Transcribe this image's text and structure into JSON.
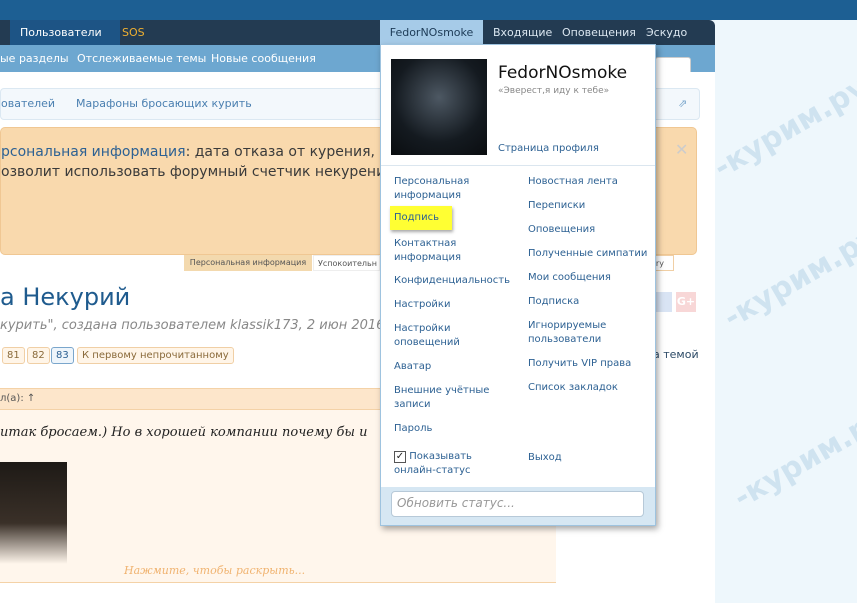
{
  "nav": {
    "users": "Пользователи",
    "sos": "SOS",
    "account": "FedorNOsmoke",
    "inbox": "Входящие",
    "alerts": "Оповещения",
    "escudo": "Эскудо"
  },
  "subnav": [
    "ые разделы",
    "Отслеживаемые темы",
    "Новые сообщения"
  ],
  "breadcrumbs": [
    "ователей",
    "Марафоны бросающих курить"
  ],
  "notice": {
    "link": "рсональная информация",
    "line1": ": дата отказа от курения, ст",
    "line2": "озволит использовать форумный счетчик некурения"
  },
  "tabs": [
    "Персональная информация",
    "Успокоительн",
    "ery"
  ],
  "thread": {
    "title": "а Некурий",
    "subtitle": "курить\", создана пользователем klassik173, 2 июн 2016.",
    "pages": [
      "81",
      "82",
      "83"
    ],
    "first_unread": "К первому непрочитанному",
    "watch": "а темой"
  },
  "quote": {
    "head": "л(а): ↑",
    "text": "итак бросаем.) Но в хорошей компании почему бы и",
    "expand": "Нажмите, чтобы раскрыть..."
  },
  "watermark": "-курим.ру",
  "menu": {
    "username": "FedorNOsmoke",
    "status": "«Эверест,я иду к тебе»",
    "profile": "Страница профиля",
    "left": [
      "Персональная информация",
      "Подпись",
      "Контактная информация",
      "Конфиденциальность",
      "Настройки",
      "Настройки оповещений",
      "Аватар",
      "Внешние учётные записи",
      "Пароль"
    ],
    "show_online": "Показывать онлайн-статус",
    "show_online_checked": true,
    "right": [
      "Новостная лента",
      "Переписки",
      "Оповещения",
      "Полученные симпатии",
      "Мои сообщения",
      "Подписка",
      "Игнорируемые пользователи",
      "Получить VIP права",
      "Список закладок"
    ],
    "logout": "Выход",
    "status_placeholder": "Обновить статус...",
    "highlight_color": "#ffff33"
  }
}
